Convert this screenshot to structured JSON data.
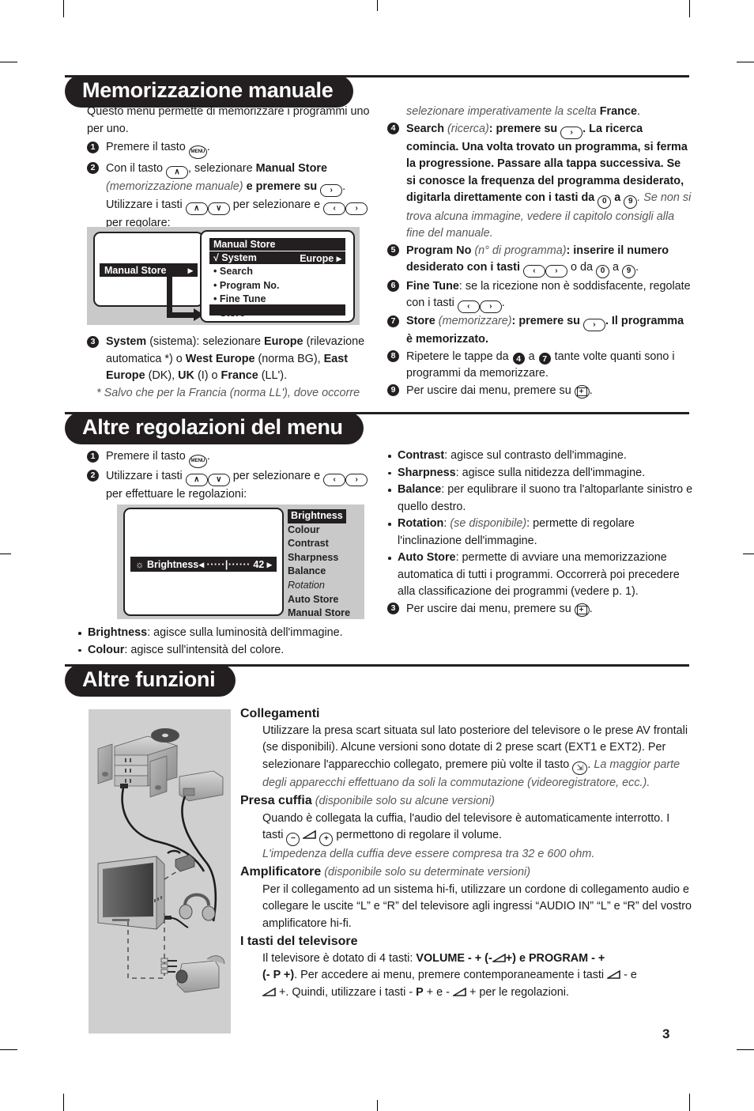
{
  "page": {
    "number": "3"
  },
  "sections": [
    {
      "id": "memorizzazione-manuale",
      "title": "Memorizzazione manuale",
      "intro": "Questo menu permette di memorizzare i programmi uno per uno.",
      "left_steps": [
        {
          "num": "1",
          "text": "Premere il tasto",
          "key": "MENU"
        },
        {
          "num": "2",
          "text": "Con il tasto",
          "text2": ", selezionare",
          "bold": "Manual Store",
          "italic": "(memorizzazione manuale)",
          "text3": "e premere su",
          "text4": "Utilizzare i tasti",
          "text5": "per selezionare e",
          "text6": "per regolare:"
        },
        {
          "num": "3",
          "bold": "System",
          "paren": "(sistema)",
          "text": ": selezionare",
          "b1": "Europe",
          "t1": "(rilevazione automatica *) o",
          "b2": "West Europe",
          "t2": "(norma BG),",
          "b3": "East Europe",
          "t3": "(DK),",
          "b4": "UK",
          "t4": "(I) o",
          "b5": "France",
          "t5": "(LL')."
        }
      ],
      "footnote": "* Salvo che per la Francia (norma LL'), dove occorre",
      "right_cont": "selezionare imperativamente la scelta",
      "right_cont_bold": "France",
      "right_steps": [
        {
          "num": "4",
          "bold": "Search",
          "paren": "(ricerca)",
          "t1": ": premere su",
          "t2": ". La ricerca comincia. Una volta trovato un programma, si ferma la progressione. Passare alla tappa successiva. Se si conosce la frequenza del programma desiderato, digitarla direttamente con i tasti da",
          "k0": "0",
          "t3": "a",
          "k9": "9",
          "ital": ". Se non si trova alcuna immagine, vedere il capitolo consigli alla fine del manuale."
        },
        {
          "num": "5",
          "bold": "Program No",
          "paren": "(n° di programma)",
          "t1": ": inserire il numero desiderato con i tasti",
          "t2": "o da",
          "k0": "0",
          "t3": "a",
          "k9": "9",
          "t4": "."
        },
        {
          "num": "6",
          "bold": "Fine Tune",
          "t1": ": se la ricezione non è soddisfacente, regolate con i tasti",
          "t2": "."
        },
        {
          "num": "7",
          "bold": "Store",
          "paren": "(memorizzare)",
          "t1": ": premere su",
          "t2": ". Il programma è memorizzato."
        },
        {
          "num": "8",
          "t1": "Ripetere le tappe da",
          "n1": "4",
          "t2": "a",
          "n2": "7",
          "t3": "tante volte quanti sono i programmi da memorizzare."
        },
        {
          "num": "9",
          "t1": "Per uscire dai menu, premere su",
          "t2": "."
        }
      ],
      "osd": {
        "left_item": "Manual Store",
        "title": "Manual Store",
        "rows": [
          {
            "mark": "√",
            "label": "System",
            "value": "Europe",
            "arrow": true,
            "selected": true
          },
          {
            "mark": "•",
            "label": "Search"
          },
          {
            "mark": "•",
            "label": "Program No."
          },
          {
            "mark": "•",
            "label": "Fine Tune"
          },
          {
            "mark": "•",
            "label": "Store"
          }
        ]
      }
    },
    {
      "id": "altre-regolazioni",
      "title": "Altre regolazioni del menu",
      "left_steps": [
        {
          "num": "1",
          "text": "Premere il tasto",
          "key": "MENU"
        },
        {
          "num": "2",
          "t1": "Utilizzare i tasti",
          "t2": "per selezionare e",
          "t3": "per effettuare le regolazioni:"
        }
      ],
      "osd": {
        "slider_label": "Brightness",
        "slider_gauge": "·····|······",
        "slider_value": "42",
        "menu_items": [
          {
            "label": "Brightness",
            "selected": true
          },
          {
            "label": "Colour"
          },
          {
            "label": "Contrast"
          },
          {
            "label": "Sharpness"
          },
          {
            "label": "Balance"
          },
          {
            "label": "Rotation",
            "italic": true
          },
          {
            "label": "Auto Store"
          },
          {
            "label": "Manual Store"
          }
        ]
      },
      "left_bullets": [
        {
          "bold": "Brightness",
          "text": ": agisce sulla luminosità dell'immagine."
        },
        {
          "bold": "Colour",
          "text": ": agisce sull'intensità del colore."
        }
      ],
      "right_bullets": [
        {
          "bold": "Contrast",
          "text": ": agisce sul contrasto dell'immagine."
        },
        {
          "bold": "Sharpness",
          "text": ": agisce sulla nitidezza dell'immagine."
        },
        {
          "bold": "Balance",
          "text": ": per equlibrare il suono tra l'altoparlante sinistro e quello destro."
        },
        {
          "bold": "Rotation",
          "italic": "(se disponibile)",
          "text": ": permette di regolare l'inclinazione dell'immagine."
        },
        {
          "bold": "Auto Store",
          "text": ": permette di avviare una memorizzazione automatica di tutti i programmi. Occorrerà poi precedere alla classificazione dei programmi (vedere p. 1)."
        }
      ],
      "exit_step": {
        "num": "3",
        "t1": "Per uscire dai menu, premere su",
        "t2": "."
      }
    },
    {
      "id": "altre-funzioni",
      "title": "Altre funzioni",
      "blocks": [
        {
          "heading": "Collegamenti",
          "body_a": "Utilizzare la presa scart situata sul lato posteriore del televisore o le prese AV frontali (se disponibili). Alcune versioni sono dotate di 2 prese scart (EXT1 e EXT2). Per selezionare l'apparecchio collegato, premere più volte il tasto",
          "body_b": ".",
          "italic": "La maggior parte degli apparecchi effettuano da soli la commutazione (videoregistratore, ecc.)."
        },
        {
          "heading": "Presa cuffia",
          "heading_italic": "(disponibile solo su alcune versioni)",
          "body_a": "Quando è collegata la cuffia, l'audio del televisore è automaticamente interrotto. I tasti",
          "body_b": "permettono di regolare il volume.",
          "italic": "L'impedenza della cuffia deve essere compresa tra 32 e 600 ohm."
        },
        {
          "heading": "Amplificatore",
          "heading_italic": "(disponibile solo su determinate versioni)",
          "body_a": "Per il collegamento ad un sistema hi-fi, utilizzare un cordone di collegamento audio e collegare le uscite “L” e “R” del televisore agli ingressi “AUDIO IN” “L” e “R” del vostro amplificatore hi-fi."
        },
        {
          "heading": "I tasti del televisore",
          "body_a": "Il televisore è dotato di 4 tasti:",
          "bold_a": "VOLUME - +",
          "mid_a": "(-",
          "mid_b": "+) e",
          "bold_b": "PROGRAM - +",
          "line2_a": "(-",
          "line2_b": "P +)",
          "line2_c": ". Per accedere ai menu, premere contemporaneamente i tasti",
          "line2_d": "- e",
          "line3_a": "+. Quindi, utilizzare i tasti -",
          "line3_b": "P",
          "line3_c": "+ e -",
          "line3_d": "+ per le regolazioni."
        }
      ],
      "illustration_alt": "hi-fi-tv-connection-diagram"
    }
  ],
  "colors": {
    "ink": "#231f20",
    "muted": "#58585b",
    "panel": "#cfcfcf"
  }
}
